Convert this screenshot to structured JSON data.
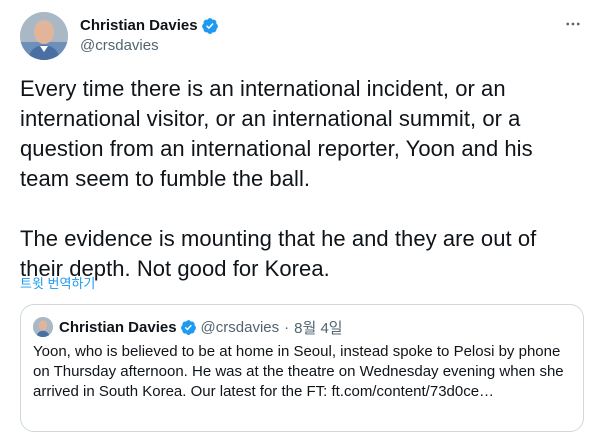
{
  "tweet": {
    "author": {
      "display_name": "Christian Davies",
      "handle": "@crsdavies",
      "verified": true
    },
    "more_icon": "more-horizontal-icon",
    "text": "Every time there is an international incident, or an international visitor, or an international summit, or a question from an international reporter, Yoon and his team seem to fumble the ball.\n\nThe evidence is mounting that he and they are out of their depth. Not good for Korea.",
    "translate_label": "트윗 번역하기"
  },
  "quote": {
    "author": {
      "display_name": "Christian Davies",
      "handle": "@crsdavies",
      "verified": true
    },
    "separator": "·",
    "date": "8월 4일",
    "text": "Yoon, who is believed to be at home in Seoul, instead spoke to Pelosi by phone on Thursday afternoon. He was at the theatre on Wednesday evening when she arrived in South Korea. Our latest for the FT: ft.com/content/73d0ce…"
  },
  "colors": {
    "accent": "#1d9bf0",
    "text": "#0f1419",
    "secondary": "#536471",
    "border": "#cfd9de"
  }
}
